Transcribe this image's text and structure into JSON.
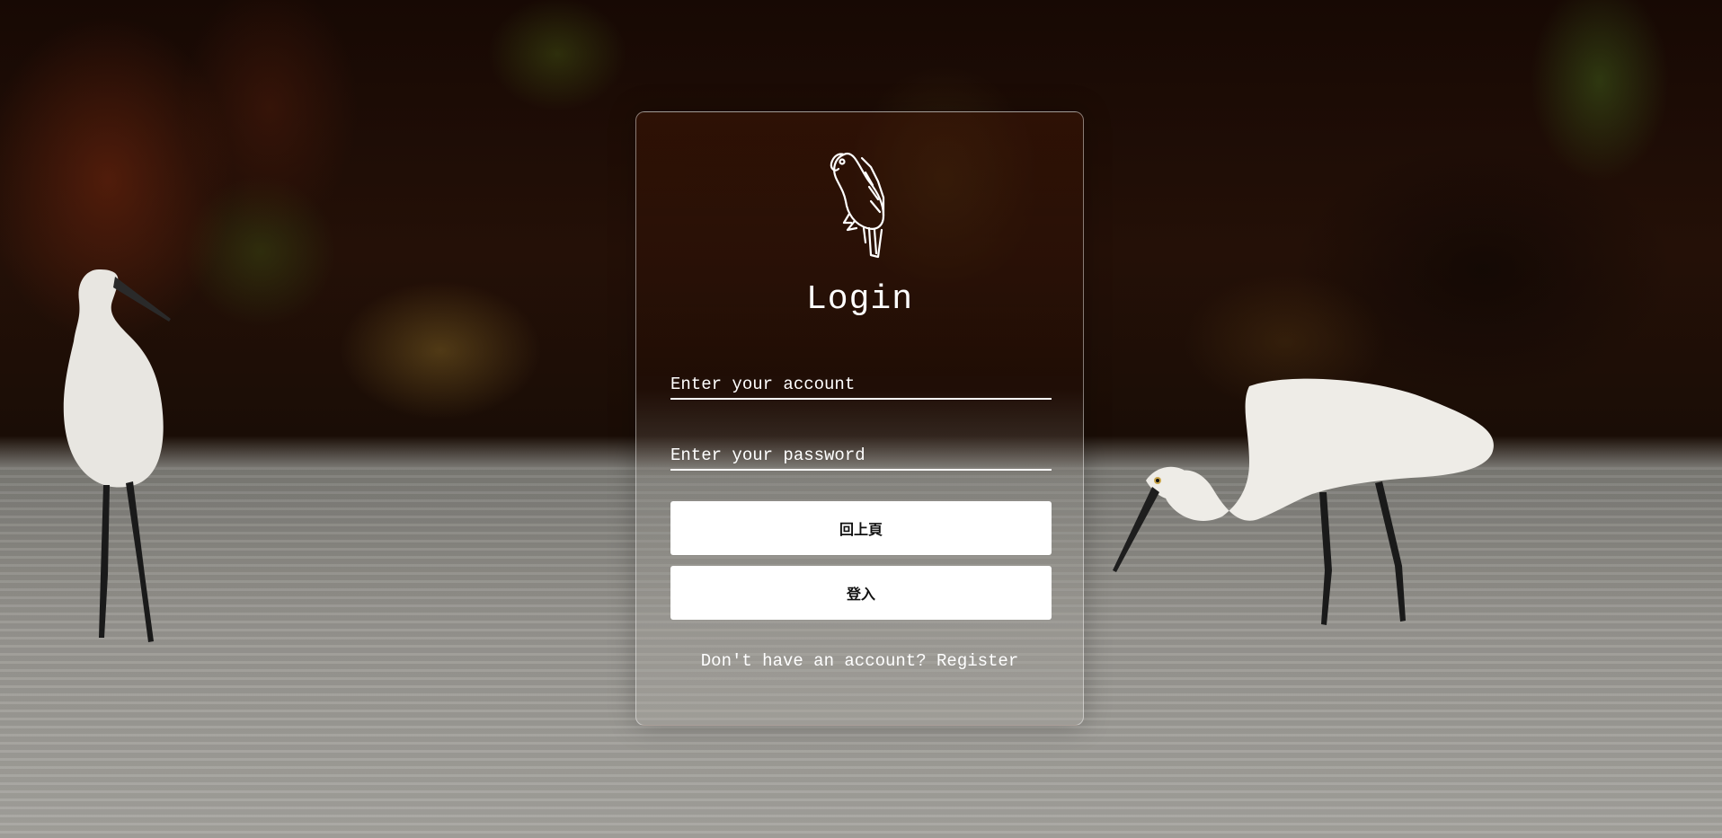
{
  "login": {
    "title": "Login",
    "account_placeholder": "Enter your account",
    "password_placeholder": "Enter your password",
    "back_label": "回上頁",
    "submit_label": "登入",
    "register_prompt": "Don't have an account?",
    "register_link": "Register"
  },
  "icons": {
    "logo": "parrot-icon"
  },
  "colors": {
    "card_border": "#ffffff",
    "button_bg": "#ffffff",
    "text": "#ffffff"
  }
}
